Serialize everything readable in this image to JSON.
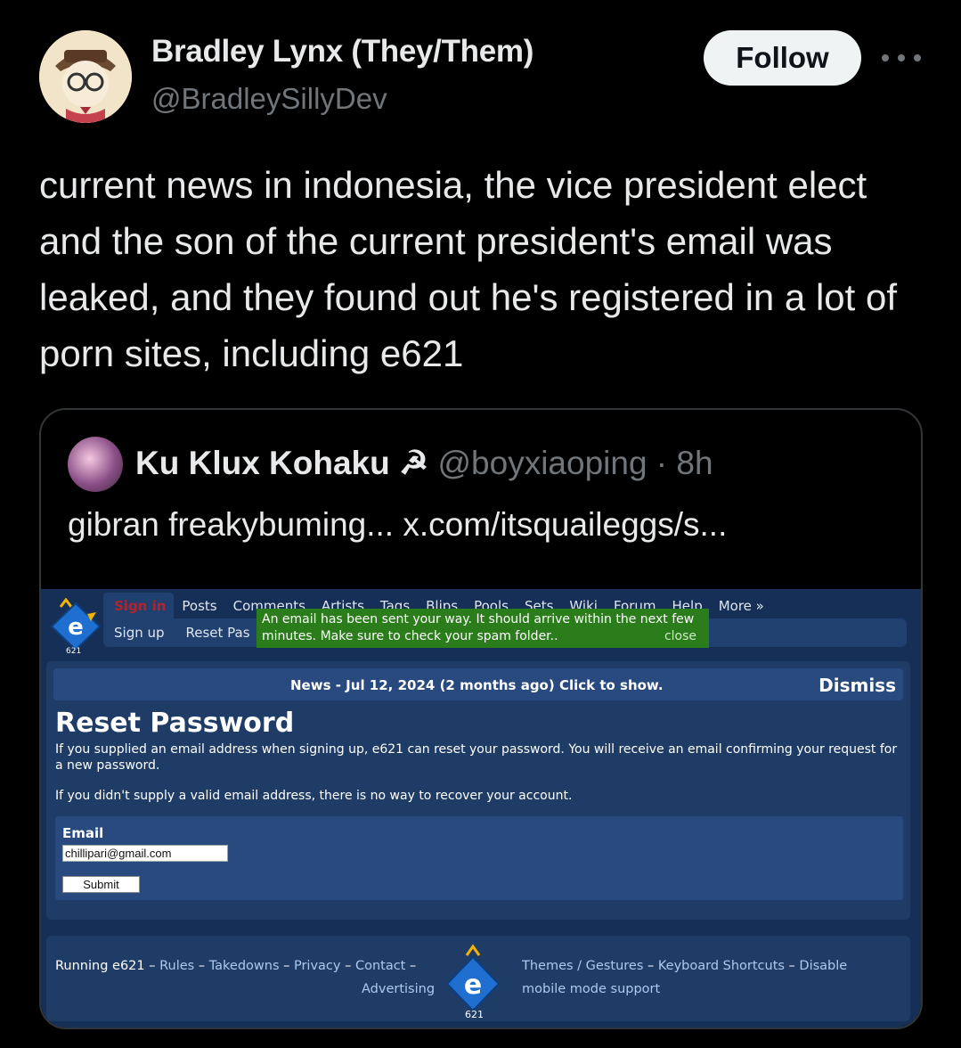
{
  "post": {
    "author_name": "Bradley Lynx (They/Them)",
    "author_handle": "@BradleySillyDev",
    "follow_label": "Follow",
    "text": "current news in indonesia, the vice president elect and the son of the current president's email was leaked, and they found out he's registered in a lot of porn sites, including e621"
  },
  "quote": {
    "name": "Ku Klux Kohaku ☭",
    "handle": "@boyxiaoping",
    "time": "8h",
    "text": "gibran freakybuming...  x.com/itsquaileggs/s..."
  },
  "site": {
    "nav_top": [
      "Sign in",
      "Posts",
      "Comments",
      "Artists",
      "Tags",
      "Blips",
      "Pools",
      "Sets",
      "Wiki",
      "Forum",
      "Help",
      "More »"
    ],
    "nav_sub": [
      "Sign up",
      "Reset Pas"
    ],
    "notice_text": "An email has been sent your way. It should arrive within the next few minutes. Make sure to check your spam folder..",
    "notice_close": "close",
    "news_text": "News - Jul 12, 2024 (2 months ago) Click to show.",
    "dismiss_label": "Dismiss",
    "page_title": "Reset Password",
    "desc1": "If you supplied an email address when signing up, e621 can reset your password. You will receive an email confirming your request for a new password.",
    "desc2": "If you didn't supply a valid email address, there is no way to recover your account.",
    "email_label": "Email",
    "email_value": "chillipari@gmail.com",
    "submit_label": "Submit",
    "footer": {
      "running": "Running e621",
      "sep": " – ",
      "links_left": [
        "Rules",
        "Takedowns",
        "Privacy",
        "Contact"
      ],
      "advertising": "Advertising",
      "links_right": [
        "Themes / Gestures",
        "Keyboard Shortcuts",
        "Disable"
      ],
      "right_line2": "mobile mode support"
    },
    "logo_text": "e",
    "logo_sub": "621"
  },
  "colors": {
    "background": "#000000",
    "site_bg": "#152f56",
    "panel": "#1f3c67",
    "notice_green": "#2a7d1a",
    "signin_red": "#b2242a",
    "link_blue": "#aec8ee"
  }
}
